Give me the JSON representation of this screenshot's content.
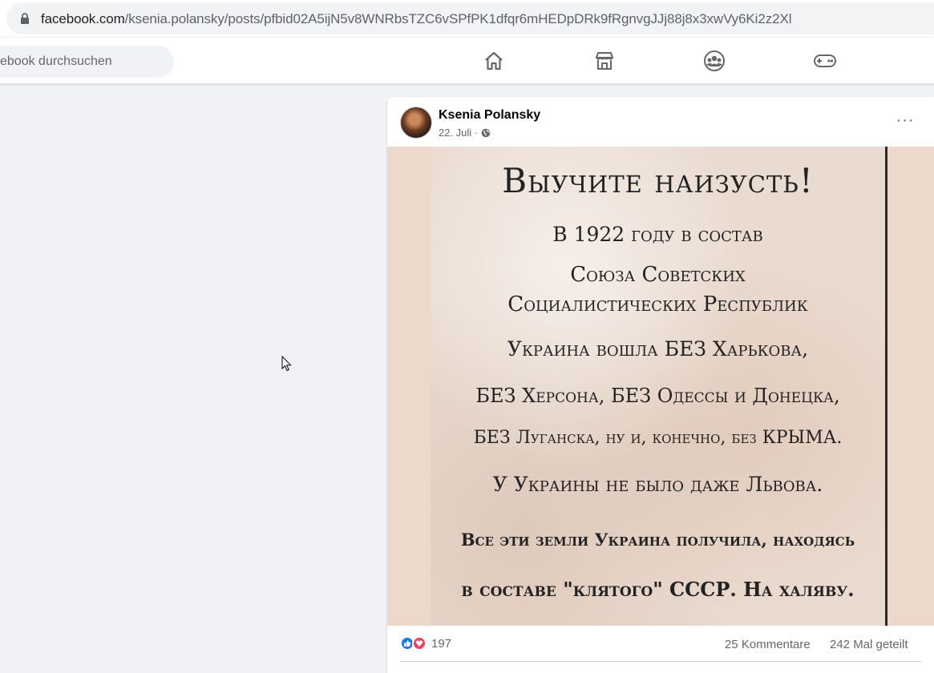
{
  "browser": {
    "url_host": "facebook.com",
    "url_path": "/ksenia.polansky/posts/pfbid02A5ijN5v8WNRbsTZC6vSPfPK1dfqr6mHEDpDRk9fRgnvgJJj88j8x3xwVy6Ki2z2Xl"
  },
  "nav": {
    "search_placeholder": "ebook durchsuchen",
    "icons": [
      "home-icon",
      "marketplace-icon",
      "groups-icon",
      "gaming-icon"
    ]
  },
  "post": {
    "author": "Ksenia Polansky",
    "date": "22. Juli ·",
    "more_label": "···",
    "image_text": {
      "title": "Выучите наизусть!",
      "line1": "В 1922 году в состав",
      "line2": "Союза Советских",
      "line3": "Социалистических Республик",
      "line4": "Украина вошла БЕЗ Харькова,",
      "line5": "БЕЗ Херсона, БЕЗ Одессы и Донецка,",
      "line6": "БЕЗ Луганска, ну и, конечно, без КРЫМА.",
      "line7": "У Украины не было даже Львова.",
      "line8": "Все эти земли Украина получила, находясь",
      "line9": "в составе \"клятого\" СССР. На халяву."
    },
    "reaction_count": "197",
    "comments": "25 Kommentare",
    "shares": "242 Mal geteilt"
  },
  "colors": {
    "fb_blue": "#1877f2",
    "love_red": "#f33e58",
    "page_bg": "#f0f2f5"
  }
}
